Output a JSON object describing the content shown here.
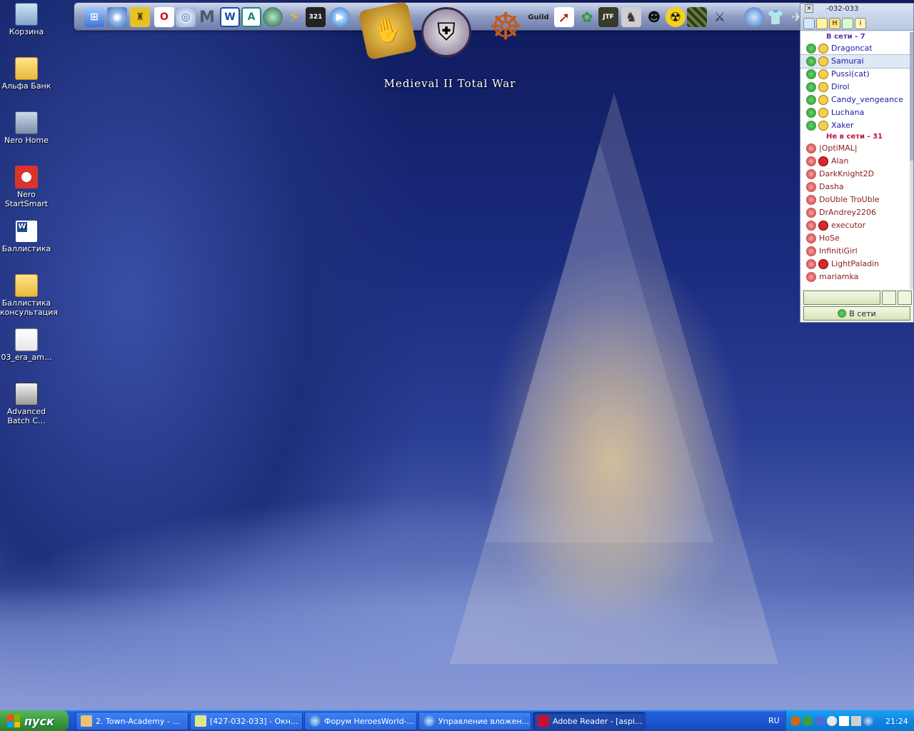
{
  "desktop": {
    "icons": [
      {
        "label": "Корзина",
        "icon": "recycle-bin-icon"
      },
      {
        "label": "Альфа Банк",
        "icon": "folder-icon"
      },
      {
        "label": "Nero Home",
        "icon": "nero-home-icon"
      },
      {
        "label": "Nero StartSmart",
        "icon": "nero-icon"
      },
      {
        "label": "Баллистика",
        "icon": "word-document-icon"
      },
      {
        "label": "Баллистика консультация",
        "icon": "folder-icon"
      },
      {
        "label": "03_era_am...",
        "icon": "file-icon"
      },
      {
        "label": "Advanced Batch C...",
        "icon": "batch-converter-icon"
      }
    ]
  },
  "launcher": {
    "game_title": "Medieval II Total War",
    "icons": [
      "windows-icon",
      "globe-icon",
      "game-icon",
      "opera-icon",
      "network-icon",
      "m-icon",
      "word-icon",
      "a-icon",
      "orb-icon",
      "flash-icon",
      "video-icon",
      "media-player-icon",
      "heroes-icon",
      "medieval-helmet-icon",
      "ship-wheel-icon",
      "guild-icon",
      "arrow-icon",
      "plant-icon",
      "jtf-icon",
      "horse-icon",
      "mask-icon",
      "radiation-icon",
      "camo-icon",
      "swords-icon",
      "globe2-icon",
      "tshirt-icon",
      "plane-icon"
    ]
  },
  "im": {
    "title": "-032-033",
    "online_group": "В сети - 7",
    "online_contacts": [
      "Dragoncat",
      "Samurai",
      "Pussi(cat)",
      "Dirol",
      "Candy_vengeance",
      "Luchana",
      "Xaker"
    ],
    "selected": "Samurai",
    "offline_group": "Не в сети - 31",
    "offline_contacts": [
      "|OptiMAL|",
      "Alan",
      "DarkKnight2D",
      "Dasha",
      "DoUble TroUble",
      "DrAndrey2206",
      "executor",
      "HoSe",
      "InfinitiGirl",
      "LightPaladin",
      "mariamka"
    ],
    "offline_flagged": [
      "Alan",
      "executor",
      "LightPaladin"
    ],
    "status_label": "В сети"
  },
  "taskbar": {
    "start_label": "пуск",
    "tasks": [
      {
        "label": "2. Town-Academy - ...",
        "icon": "pencil-icon"
      },
      {
        "label": "[427-032-033] - Окн...",
        "icon": "chat-window-icon"
      },
      {
        "label": "Форум HeroesWorld-...",
        "icon": "ie-icon"
      },
      {
        "label": "Управление вложен...",
        "icon": "ie-icon"
      },
      {
        "label": "Adobe Reader - [aspi...",
        "icon": "adobe-reader-icon"
      }
    ],
    "language": "RU",
    "clock": "21:24"
  },
  "colors": {
    "taskbar": "#245edb",
    "start": "#3c9a3c",
    "tray": "#0f86e0",
    "online_header": "#5d2fb2",
    "offline_header": "#c0143c"
  }
}
